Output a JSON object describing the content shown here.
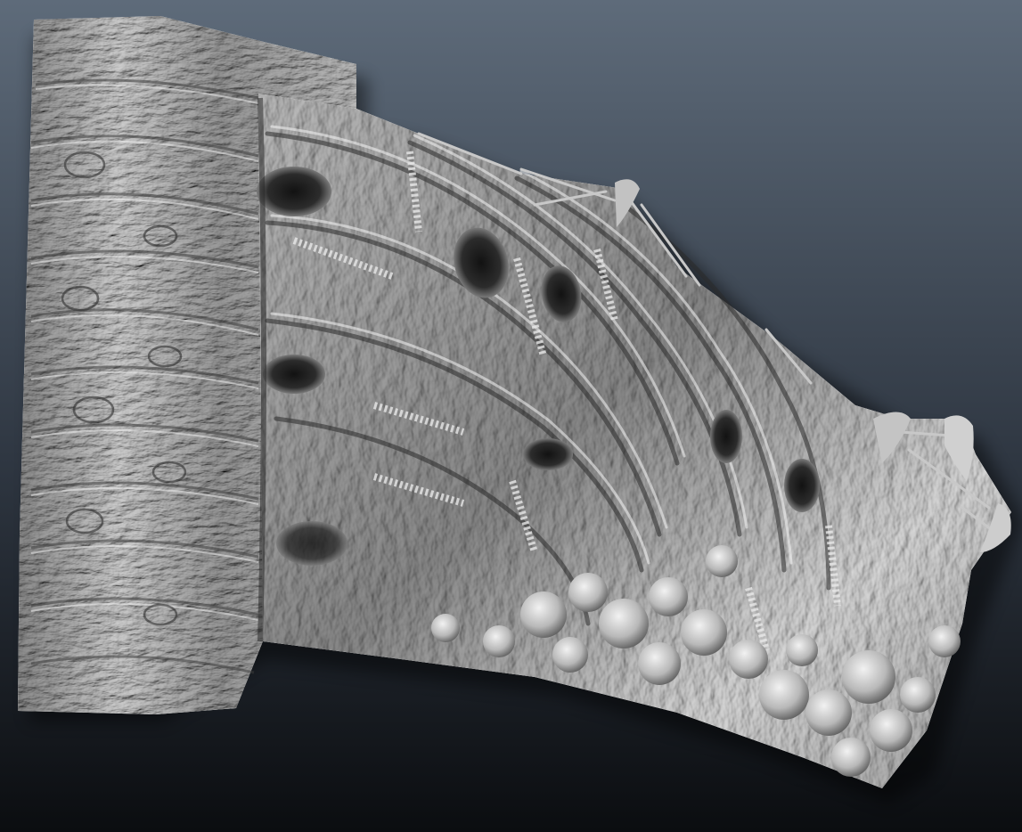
{
  "scene": {
    "colors": {
      "background_top": "#5e6b7a",
      "background_mid": "#2f3742",
      "background_bottom": "#0b0d10",
      "surface_light": "#e6e6e6",
      "surface_mid": "#a9a9a9",
      "surface_dark": "#3a3a3a",
      "shadow": "#101214"
    },
    "subject": "sculpted-relief-panel",
    "material": "gray-clay"
  }
}
